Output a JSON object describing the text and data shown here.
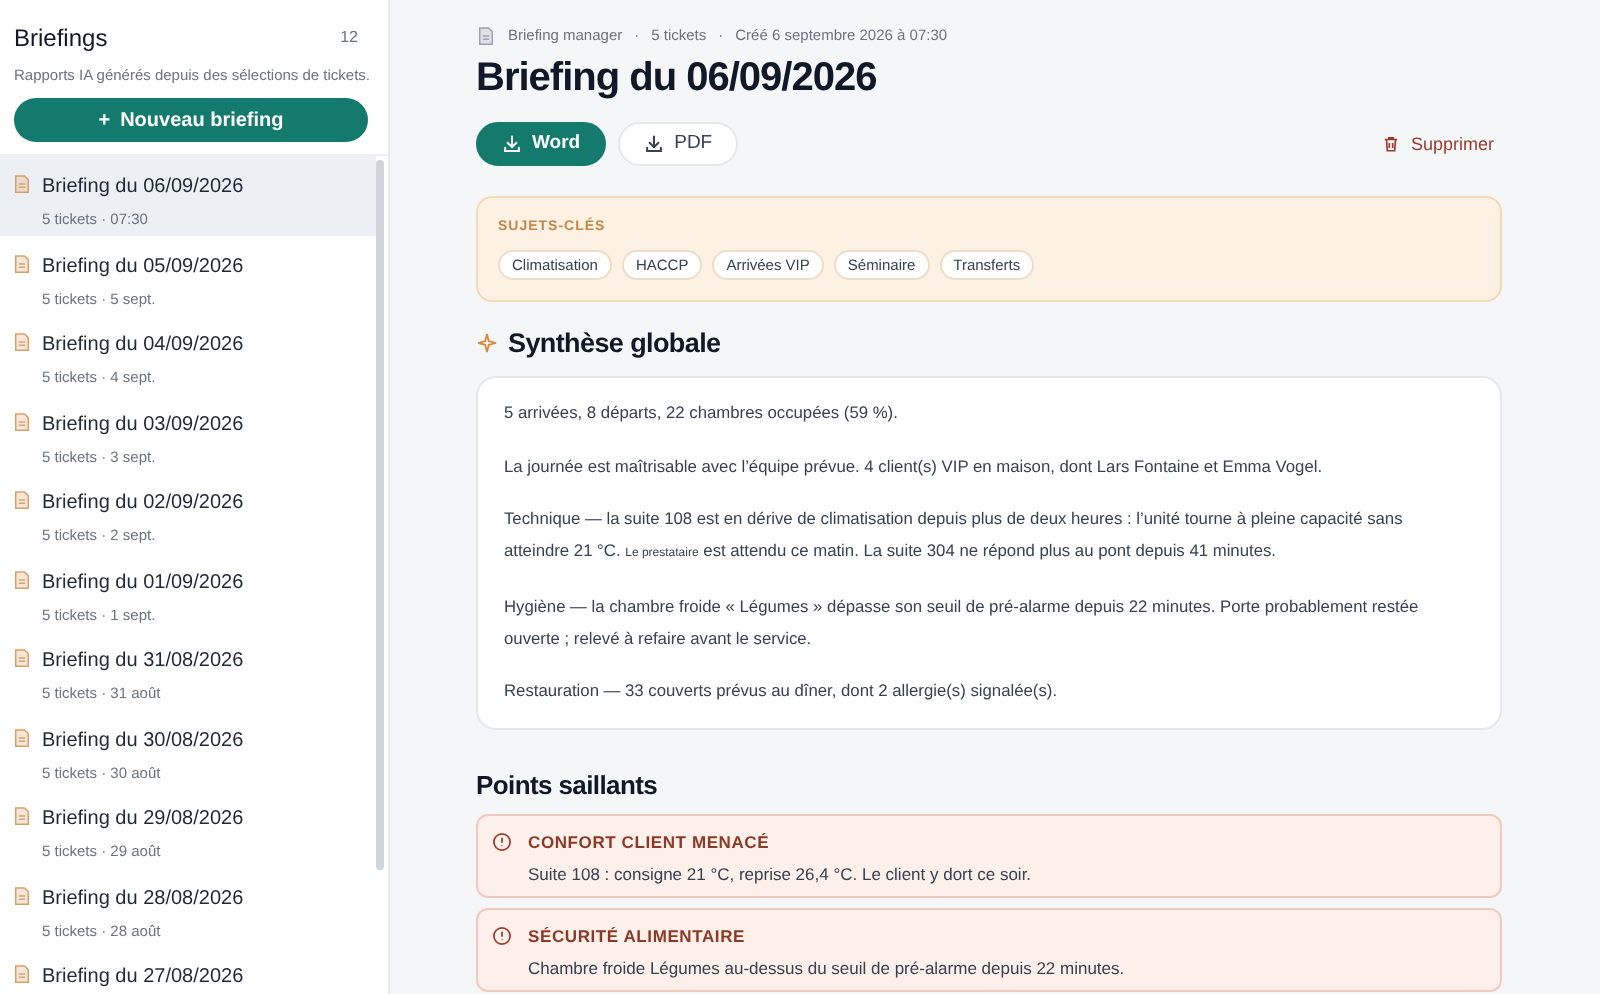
{
  "sidebar": {
    "title": "Briefings",
    "count": "12",
    "description": "Rapports IA générés depuis des sélections de tickets.",
    "new_button": {
      "icon": "+",
      "label": "Nouveau briefing"
    },
    "items": [
      {
        "title": "Briefing du 06/09/2026",
        "meta": "5 tickets · 07:30",
        "selected": true
      },
      {
        "title": "Briefing du 05/09/2026",
        "meta": "5 tickets · 5 sept.",
        "selected": false
      },
      {
        "title": "Briefing du 04/09/2026",
        "meta": "5 tickets · 4 sept.",
        "selected": false
      },
      {
        "title": "Briefing du 03/09/2026",
        "meta": "5 tickets · 3 sept.",
        "selected": false
      },
      {
        "title": "Briefing du 02/09/2026",
        "meta": "5 tickets · 2 sept.",
        "selected": false
      },
      {
        "title": "Briefing du 01/09/2026",
        "meta": "5 tickets · 1 sept.",
        "selected": false
      },
      {
        "title": "Briefing du 31/08/2026",
        "meta": "5 tickets · 31 août",
        "selected": false
      },
      {
        "title": "Briefing du 30/08/2026",
        "meta": "5 tickets · 30 août",
        "selected": false
      },
      {
        "title": "Briefing du 29/08/2026",
        "meta": "5 tickets · 29 août",
        "selected": false
      },
      {
        "title": "Briefing du 28/08/2026",
        "meta": "5 tickets · 28 août",
        "selected": false
      },
      {
        "title": "Briefing du 27/08/2026",
        "selected": false
      }
    ]
  },
  "breadcrumb": [
    "Briefing manager",
    "5 tickets",
    "Créé 6 septembre 2026 à 07:30"
  ],
  "breadcrumb_separator": "·",
  "title": "Briefing du 06/09/2026",
  "actions": [
    {
      "label": "Word",
      "kind": "primary"
    },
    {
      "label": "PDF",
      "kind": "secondary"
    }
  ],
  "delete_button": "Supprimer",
  "keywords": {
    "title": "SUJETS-CLÉS",
    "tags": [
      "Climatisation",
      "HACCP",
      "Arrivées VIP",
      "Séminaire",
      "Transferts"
    ]
  },
  "summary": {
    "title": "Synthèse globale",
    "paragraphs": [
      [
        {
          "text": "5 arrivées, 8 départs, 22 chambres occupées (59 %).",
          "small": false
        }
      ],
      [
        {
          "text": "La journée est maîtrisable avec l’équipe prévue. 4 client(s) VIP en maison, dont Lars Fontaine et Emma Vogel.",
          "small": false
        }
      ],
      [
        {
          "text": "Technique — la suite 108 est en dérive de climatisation depuis plus de deux heures : l’unité tourne à pleine capacité sans atteindre 21 °C. ",
          "small": false
        },
        {
          "text": "Le prestataire",
          "small": true
        },
        {
          "text": " est attendu ce matin. La suite 304 ne répond plus au pont depuis 41 minutes.",
          "small": false
        }
      ],
      [
        {
          "text": "Hygiène — la chambre froide « Légumes » dépasse son seuil de pré-alarme depuis 22 minutes. Porte probablement restée ouverte ; relevé à refaire avant le service.",
          "small": false
        }
      ],
      [
        {
          "text": "Restauration — 33 couverts prévus au dîner, dont 2 allergie(s) signalée(s).",
          "small": false
        }
      ]
    ]
  },
  "highlights": {
    "title": "Points saillants",
    "items": [
      {
        "title": "CONFORT CLIENT MENACÉ",
        "text": "Suite 108 : consigne 21 °C, reprise 26,4 °C. Le client y dort ce soir."
      },
      {
        "title": "SÉCURITÉ ALIMENTAIRE",
        "text": "Chambre froide Légumes au-dessus du seuil de pré-alarme depuis 22 minutes."
      }
    ]
  }
}
